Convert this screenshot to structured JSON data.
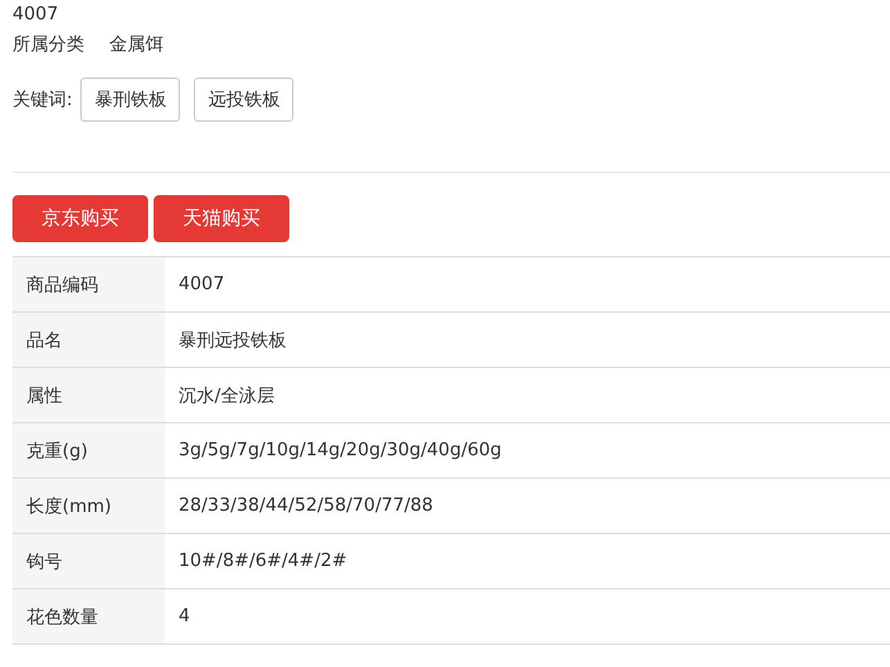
{
  "product_code": "4007",
  "category": {
    "label": "所属分类",
    "value": "金属饵"
  },
  "keywords": {
    "label": "关键词:",
    "items": [
      "暴刑铁板",
      "远投铁板"
    ]
  },
  "buy_buttons": [
    "京东购买",
    "天猫购买"
  ],
  "specs": [
    {
      "label": "商品编码",
      "value": "4007"
    },
    {
      "label": "品名",
      "value": "暴刑远投铁板"
    },
    {
      "label": "属性",
      "value": "沉水/全泳层"
    },
    {
      "label": "克重(g)",
      "value": "3g/5g/7g/10g/14g/20g/30g/40g/60g"
    },
    {
      "label": "长度(mm)",
      "value": "28/33/38/44/52/58/70/77/88"
    },
    {
      "label": "钩号",
      "value": "10#/8#/6#/4#/2#"
    },
    {
      "label": "花色数量",
      "value": "4"
    }
  ]
}
